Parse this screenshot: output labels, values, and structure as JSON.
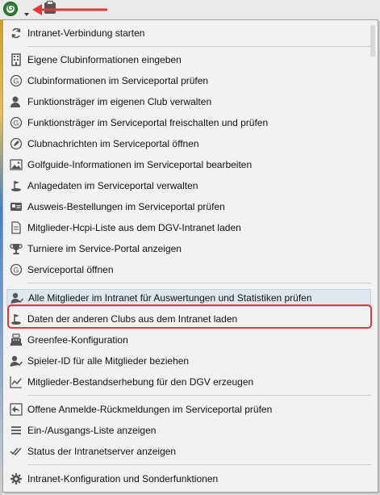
{
  "toolbar": {
    "app_icon": "golf-g-logo-icon",
    "print_icon": "printer-icon"
  },
  "colors": {
    "accent_red": "#e53935",
    "highlight": "#dfe6ee",
    "logo_green": "#2e7d32"
  },
  "menu": {
    "items": [
      {
        "label": "Intranet-Verbindung starten",
        "icon": "sync-icon"
      },
      {
        "label": "Eigene Clubinformationen eingeben",
        "icon": "building-icon"
      },
      {
        "label": "Clubinformationen im Serviceportal prüfen",
        "icon": "g-circle-icon"
      },
      {
        "label": "Funktionsträger im eigenen Club verwalten",
        "icon": "person-icon"
      },
      {
        "label": "Funktionsträger im Serviceportal freischalten und prüfen",
        "icon": "g-circle-icon"
      },
      {
        "label": "Clubnachrichten im Serviceportal öffnen",
        "icon": "pen-circle-icon"
      },
      {
        "label": "Golfguide-Informationen im Serviceportal bearbeiten",
        "icon": "image-icon"
      },
      {
        "label": "Anlagedaten im Serviceportal verwalten",
        "icon": "course-icon"
      },
      {
        "label": "Ausweis-Bestellungen im Serviceportal prüfen",
        "icon": "id-card-icon"
      },
      {
        "label": "Mitglieder-Hcpi-Liste aus dem DGV-Intranet laden",
        "icon": "document-icon"
      },
      {
        "label": "Turniere im Service-Portal anzeigen",
        "icon": "trophy-icon"
      },
      {
        "label": "Serviceportal öffnen",
        "icon": "g-circle-icon"
      },
      {
        "label": "Alle Mitglieder im Intranet für Auswertungen und Statistiken prüfen",
        "icon": "person-check-icon"
      },
      {
        "label": "Daten der anderen Clubs aus dem Intranet laden",
        "icon": "course-icon"
      },
      {
        "label": "Greenfee-Konfiguration",
        "icon": "cash-register-icon"
      },
      {
        "label": "Spieler-ID für alle Mitglieder beziehen",
        "icon": "person-check-icon"
      },
      {
        "label": "Mitglieder-Bestandserhebung für den DGV erzeugen",
        "icon": "chart-line-icon"
      },
      {
        "label": "Offene Anmelde-Rückmeldungen im Serviceportal prüfen",
        "icon": "reply-icon"
      },
      {
        "label": "Ein-/Ausgangs-Liste anzeigen",
        "icon": "list-icon"
      },
      {
        "label": "Status der Intranetserver anzeigen",
        "icon": "double-check-icon"
      },
      {
        "label": "Intranet-Konfiguration und Sonderfunktionen",
        "icon": "gear-icon"
      }
    ]
  }
}
